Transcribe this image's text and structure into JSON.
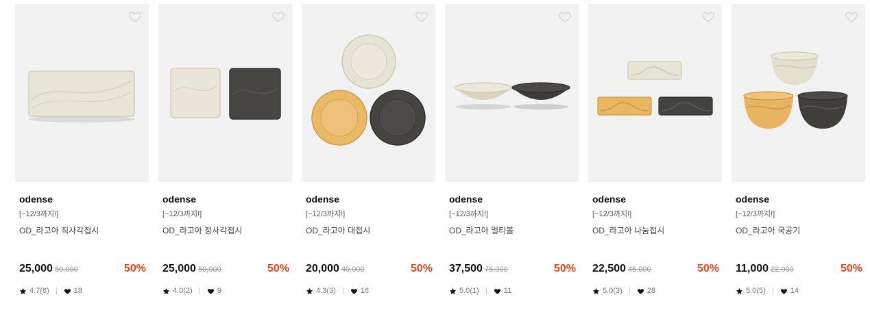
{
  "colors": {
    "discount": "#e8431d",
    "thumb_bg": "#f2f2f2"
  },
  "icons": {
    "wishlist": "heart-outline-icon",
    "rating": "star-icon",
    "likes": "heart-filled-icon"
  },
  "products": [
    {
      "brand": "odense",
      "promo": "[~12/3까지!]",
      "name": "OD_라고아 직사각접시",
      "price": "25,000",
      "original_price": "50,000",
      "discount": "50%",
      "rating": "4.7(6)",
      "likes": "18"
    },
    {
      "brand": "odense",
      "promo": "[~12/3까지!]",
      "name": "OD_라고아 정사각접시",
      "price": "25,000",
      "original_price": "50,000",
      "discount": "50%",
      "rating": "4.0(2)",
      "likes": "9"
    },
    {
      "brand": "odense",
      "promo": "[~12/3까지!]",
      "name": "OD_라고아 대접시",
      "price": "20,000",
      "original_price": "40,000",
      "discount": "50%",
      "rating": "4.3(3)",
      "likes": "16"
    },
    {
      "brand": "odense",
      "promo": "[~12/3까지!]",
      "name": "OD_라고아 멀티볼",
      "price": "37,500",
      "original_price": "75,000",
      "discount": "50%",
      "rating": "5.0(1)",
      "likes": "11"
    },
    {
      "brand": "odense",
      "promo": "[~12/3까지!]",
      "name": "OD_라고아 나눔접시",
      "price": "22,500",
      "original_price": "45,000",
      "discount": "50%",
      "rating": "5.0(3)",
      "likes": "28"
    },
    {
      "brand": "odense",
      "promo": "[~12/3까지!]",
      "name": "OD_라고아 국공기",
      "price": "11,000",
      "original_price": "22,000",
      "discount": "50%",
      "rating": "5.0(5)",
      "likes": "14"
    }
  ]
}
